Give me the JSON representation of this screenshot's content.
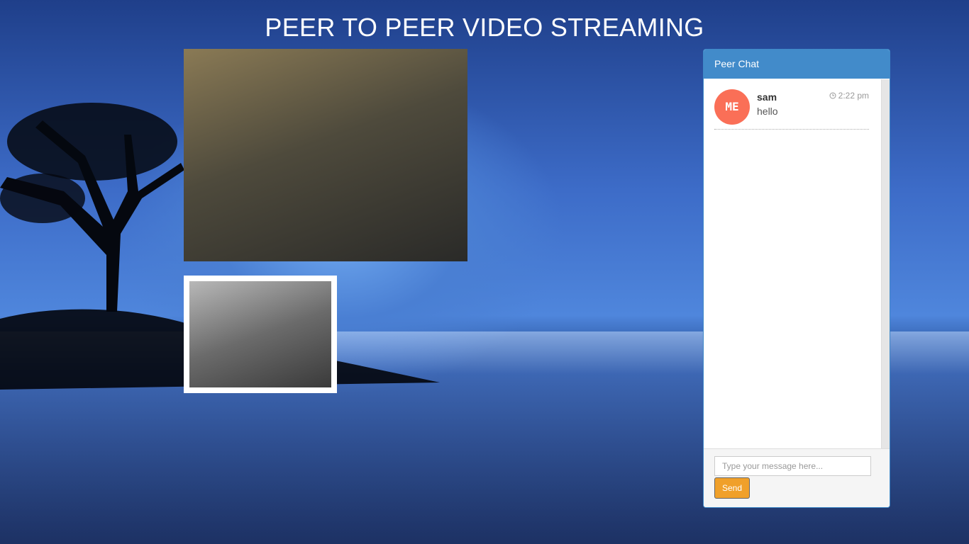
{
  "page": {
    "title": "PEER TO PEER VIDEO STREAMING"
  },
  "chat": {
    "header": "Peer Chat",
    "messages": [
      {
        "avatar": "ME",
        "name": "sam",
        "text": "hello",
        "time": "2:22 pm",
        "time_icon": "clock-icon"
      }
    ],
    "input_placeholder": "Type your message here...",
    "send_label": "Send"
  },
  "colors": {
    "chat_header": "#428bca",
    "avatar": "#fa6f57",
    "send_button": "#f0a02a"
  }
}
